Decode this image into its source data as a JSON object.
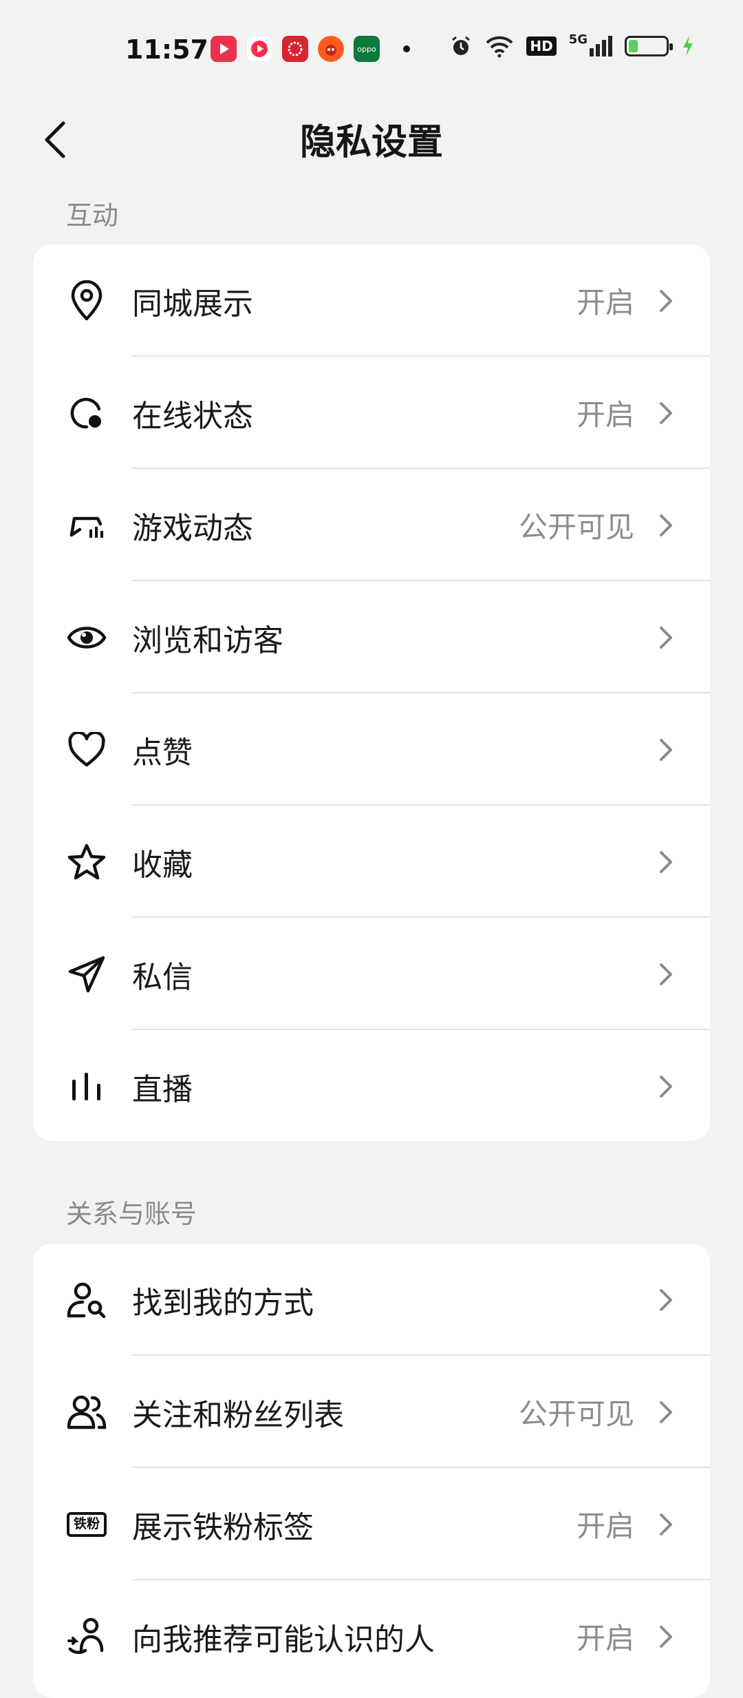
{
  "status_bar": {
    "time": "11:57",
    "hd": "HD",
    "network": "5G",
    "battery_level": 0.25,
    "app_icons": [
      "video-app-icon",
      "play-app-icon",
      "gallery-app-icon",
      "mascot-app-icon",
      "oppo-app-icon"
    ],
    "oppo_text": "oppo"
  },
  "header": {
    "title": "隐私设置"
  },
  "sections": [
    {
      "label": "互动",
      "items": [
        {
          "icon": "location-pin-icon",
          "label": "同城展示",
          "value": "开启"
        },
        {
          "icon": "online-status-icon",
          "label": "在线状态",
          "value": "开启"
        },
        {
          "icon": "game-controller-icon",
          "label": "游戏动态",
          "value": "公开可见"
        },
        {
          "icon": "eye-icon",
          "label": "浏览和访客",
          "value": ""
        },
        {
          "icon": "heart-icon",
          "label": "点赞",
          "value": ""
        },
        {
          "icon": "star-icon",
          "label": "收藏",
          "value": ""
        },
        {
          "icon": "send-icon",
          "label": "私信",
          "value": ""
        },
        {
          "icon": "live-bars-icon",
          "label": "直播",
          "value": ""
        }
      ]
    },
    {
      "label": "关系与账号",
      "items": [
        {
          "icon": "find-person-icon",
          "label": "找到我的方式",
          "value": ""
        },
        {
          "icon": "followers-icon",
          "label": "关注和粉丝列表",
          "value": "公开可见"
        },
        {
          "icon": "fan-badge-icon",
          "label": "展示铁粉标签",
          "value": "开启",
          "badge_text": "铁粉"
        },
        {
          "icon": "recommend-person-icon",
          "label": "向我推荐可能认识的人",
          "value": "开启"
        }
      ]
    }
  ],
  "colors": {
    "background": "#f2f2f2",
    "card": "#ffffff",
    "text": "#1a1a1a",
    "secondary_text": "#8c8c8c",
    "battery": "#5ad05a"
  }
}
